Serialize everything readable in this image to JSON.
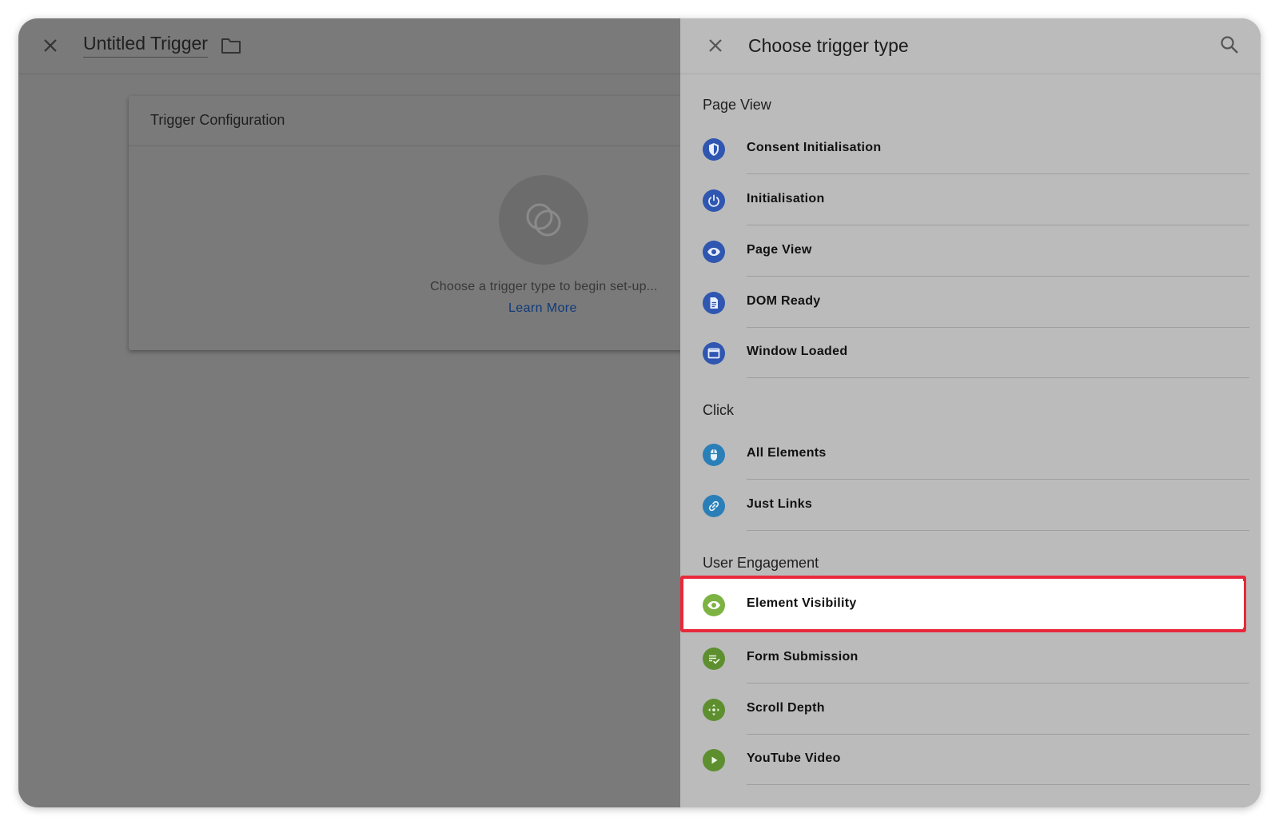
{
  "left": {
    "title": "Untitled Trigger",
    "card_title": "Trigger Configuration",
    "empty_text": "Choose a trigger type to begin set-up...",
    "learn_more": "Learn More"
  },
  "right": {
    "title": "Choose trigger type",
    "sections": [
      {
        "label": "Page View",
        "items": [
          {
            "label": "Consent Initialisation",
            "icon": "shield-icon",
            "color": "#2f56b0"
          },
          {
            "label": "Initialisation",
            "icon": "power-icon",
            "color": "#2f56b0"
          },
          {
            "label": "Page View",
            "icon": "eye-icon",
            "color": "#2f56b0"
          },
          {
            "label": "DOM Ready",
            "icon": "document-icon",
            "color": "#2f56b0"
          },
          {
            "label": "Window Loaded",
            "icon": "window-icon",
            "color": "#2f56b0"
          }
        ]
      },
      {
        "label": "Click",
        "items": [
          {
            "label": "All Elements",
            "icon": "mouse-icon",
            "color": "#2a7fb8"
          },
          {
            "label": "Just Links",
            "icon": "link-icon",
            "color": "#2a7fb8"
          }
        ]
      },
      {
        "label": "User Engagement",
        "items": [
          {
            "label": "Element Visibility",
            "icon": "eye-icon",
            "color": "#7cb342",
            "selected": true
          },
          {
            "label": "Form Submission",
            "icon": "form-check-icon",
            "color": "#5d8f2f"
          },
          {
            "label": "Scroll Depth",
            "icon": "move-icon",
            "color": "#5d8f2f"
          },
          {
            "label": "YouTube Video",
            "icon": "play-icon",
            "color": "#5d8f2f"
          }
        ]
      }
    ]
  },
  "colors": {
    "highlight_border": "#e8293b",
    "link": "#0f3a7a"
  }
}
